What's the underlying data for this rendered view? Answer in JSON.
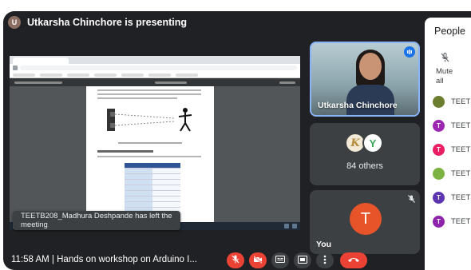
{
  "presenting": {
    "avatar_letter": "U",
    "text": "Utkarsha Chinchore is presenting"
  },
  "toast": {
    "text": "TEETB208_Madhura Deshpande has left the meeting"
  },
  "tiles": {
    "presenter_name": "Utkarsha Chinchore",
    "others_letter_1": "K",
    "others_letter_2": "Y",
    "others_label": "84 others",
    "you_letter": "T",
    "you_label": "You"
  },
  "bottom_bar": {
    "meeting_info": "11:58 AM  |  Hands on workshop on Arduino I..."
  },
  "people_panel": {
    "title": "People",
    "mute_label_line1": "Mute",
    "mute_label_line2": "all",
    "participants": [
      {
        "letter": "",
        "name": "TEETE",
        "color": "#6b7d2e"
      },
      {
        "letter": "T",
        "name": "TEETE",
        "color": "#9c27b0"
      },
      {
        "letter": "T",
        "name": "TEETE",
        "color": "#e91e63"
      },
      {
        "letter": "",
        "name": "TEETE",
        "color": "#7cb342"
      },
      {
        "letter": "T",
        "name": "TEETE",
        "color": "#5e35b1"
      },
      {
        "letter": "T",
        "name": "TEETE",
        "color": "#8e24aa"
      }
    ]
  },
  "colors": {
    "meet_bg": "#202124",
    "tile_bg": "#3c4043",
    "red": "#ea4335",
    "accent_blue": "#8ab4f8",
    "you_avatar": "#e8542a"
  },
  "icons": {
    "mic_off": "mic-off-icon",
    "camera_off": "camera-off-icon",
    "captions": "captions-icon",
    "present": "present-screen-icon",
    "more": "more-options-icon",
    "end_call": "end-call-icon"
  }
}
